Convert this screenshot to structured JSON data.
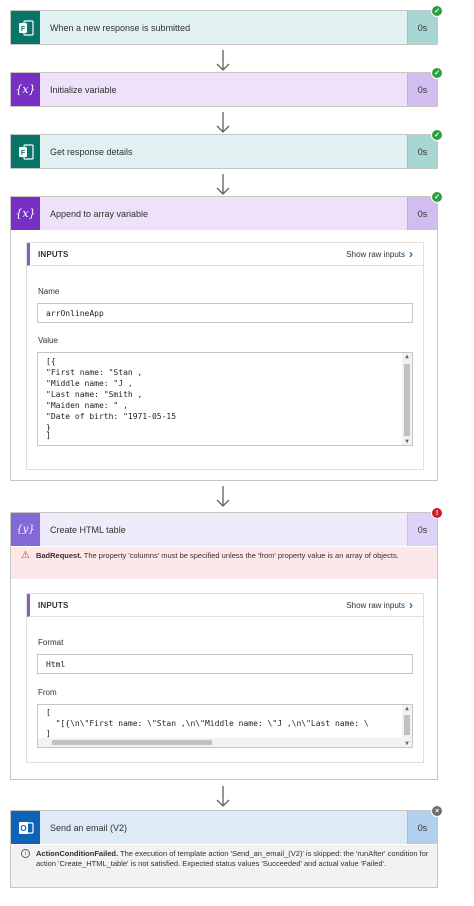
{
  "steps": {
    "trigger": {
      "title": "When a new response is submitted",
      "duration": "0s",
      "icon": "forms-icon",
      "status": "succeeded"
    },
    "init_var": {
      "title": "Initialize variable",
      "duration": "0s",
      "icon": "variable-icon",
      "status": "succeeded"
    },
    "get_details": {
      "title": "Get response details",
      "duration": "0s",
      "icon": "forms-icon",
      "status": "succeeded"
    },
    "append": {
      "title": "Append to array variable",
      "duration": "0s",
      "icon": "variable-icon",
      "status": "succeeded",
      "inputs_label": "INPUTS",
      "show_raw": "Show raw inputs",
      "name_label": "Name",
      "name_value": "arrOnlineApp",
      "value_label": "Value",
      "value_lines": [
        "[{",
        "\"First name: \"Stan ,",
        "\"Middle name: \"J ,",
        "\"Last name: \"Smith ,",
        "\"Maiden name: \" ,",
        "\"Date of birth: \"1971-05-15",
        "}",
        "]"
      ]
    },
    "html_table": {
      "title": "Create HTML table",
      "duration": "0s",
      "icon": "table-icon",
      "status": "failed",
      "error_code": "BadRequest.",
      "error_text": " The property 'columns' must be specified unless the 'from' property value is an array of objects.",
      "inputs_label": "INPUTS",
      "show_raw": "Show raw inputs",
      "format_label": "Format",
      "format_value": "Html",
      "from_label": "From",
      "from_lines": [
        "[",
        "  \"[{\\n\\\"First name: \\\"Stan ,\\n\\\"Middle name: \\\"J ,\\n\\\"Last name: \\",
        "]"
      ]
    },
    "send_email": {
      "title": "Send an email (V2)",
      "duration": "0s",
      "icon": "outlook-icon",
      "status": "skipped",
      "msg_code": "ActionConditionFailed.",
      "msg_text": " The execution of template action 'Send_an_email_(V2)' is skipped: the 'runAfter' condition for action 'Create_HTML_table' is not satisfied. Expected status values 'Succeeded' and actual value 'Failed'."
    }
  },
  "colors": {
    "forms": "#077568",
    "variable": "#782fc4",
    "table": "#8368d8",
    "outlook": "#0f63b4",
    "success": "#2f9e3f",
    "error": "#c91f28",
    "error_bg": "#fde7e9"
  }
}
